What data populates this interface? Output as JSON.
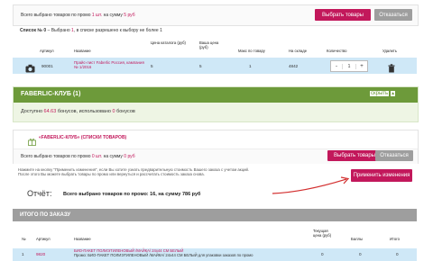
{
  "promo1": {
    "summary_prefix": "Всего выбрано товаров по промо ",
    "summary_count": "1 шт.",
    "summary_mid": " на сумму ",
    "summary_sum": "5 руб",
    "select_btn": "Выбрать товары",
    "cancel_btn": "Отказаться"
  },
  "list0": {
    "title": "Список № 0",
    "desc_before": " – Выбрано ",
    "desc_count": "1",
    "desc_after": ", в списке разрешено к выбору не более 1",
    "columns": [
      "Артикул",
      "Название",
      "Цена каталога (руб)",
      "Ваша цена (руб)",
      "Макс по товару",
      "На складе",
      "Количество",
      "Удалить"
    ],
    "row": {
      "article": "90001",
      "name": "Прайс-лист Faberlic Россия, кампания № 1/2016",
      "catalog_price": "5",
      "your_price": "5",
      "max": "1",
      "stock": "4842",
      "qty": "1",
      "minus": "-",
      "plus": "+"
    }
  },
  "club": {
    "title": "FABERLIC-КЛУБ (1)",
    "hide_link": "скрыть",
    "bonus_prefix": "Доступно ",
    "bonus_available": "64.63",
    "bonus_mid": " бонусов, использовано ",
    "bonus_used": "0",
    "bonus_suffix": " бонусов"
  },
  "club_list": {
    "label": "«FABERLIC-КЛУБ» (СПИСКИ ТОВАРОВ)",
    "summary_prefix": "Всего выбрано товаров по промо ",
    "summary_count": "0 шт.",
    "summary_mid": " на сумму ",
    "summary_sum": "0 руб",
    "select_btn": "Выбрать товары",
    "cancel_btn": "Отказаться"
  },
  "apply": {
    "note_line1": "Нажмите на кнопку \"Применить изменения\", если Вы хотите узнать предварительную стоимость Вашего заказа с учетом акций.",
    "note_line2": "После этого Вы можете выбрать товары по промо или вернуться и рассчитать стоимость заказа снова.",
    "button": "Применить изменения"
  },
  "report": {
    "label": "Отчёт:",
    "text": "Всего выбрано товаров по промо: 16, на сумму 786 руб"
  },
  "order": {
    "title": "ИТОГО ПО ЗАКАЗУ",
    "columns": [
      "№",
      "Артикул",
      "Название",
      "Текущая цена (руб)",
      "Баллы",
      "Итого"
    ],
    "row": {
      "num": "1",
      "article": "9820",
      "name_line1": "БИО-ПАКЕТ ПОЛИЭТИЛЕНОВЫЙ /МАЙКА/ 24х44 СМ БЕЛЫЙ",
      "name_line2": "Промо: БИО-ПАКЕТ ПОЛИЭТИЛЕНОВЫЙ /МАЙКА/ 24х44 СМ БЕЛЫЙ для упаковки заказов по промо",
      "price": "0",
      "points": "0",
      "total": "0"
    }
  },
  "colors": {
    "accent": "#c2185b",
    "club_green": "#6d9a3a",
    "row_blue": "#cfe8f7",
    "bonus_bg": "#eef5e4",
    "order_header": "#9e9e9e"
  },
  "icons": [
    "camera-icon",
    "trash-icon",
    "gift-icon",
    "arrow-annotation"
  ]
}
